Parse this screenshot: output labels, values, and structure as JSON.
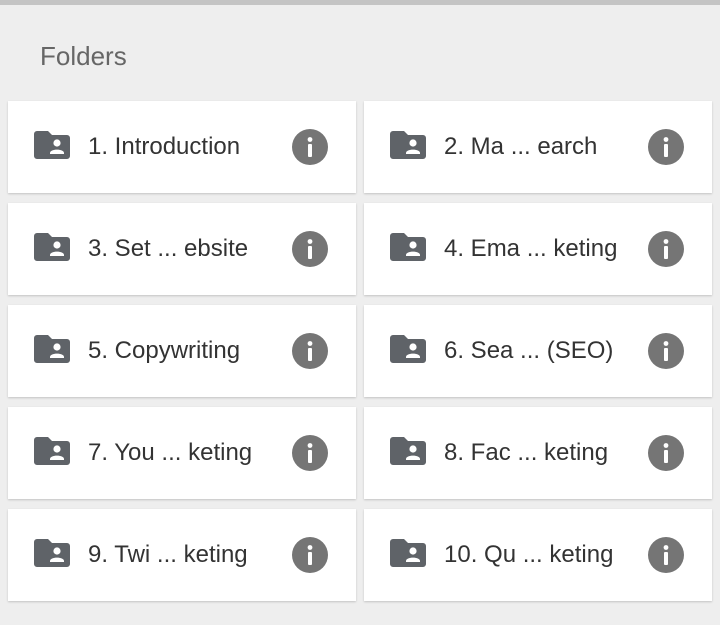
{
  "header": {
    "title": "Folders"
  },
  "folders": [
    {
      "label": "1. Introduction",
      "icon": "folder-shared-icon"
    },
    {
      "label": "2. Ma ... earch",
      "icon": "folder-shared-icon"
    },
    {
      "label": "3. Set ... ebsite",
      "icon": "folder-shared-icon"
    },
    {
      "label": "4. Ema ... keting",
      "icon": "folder-shared-icon"
    },
    {
      "label": "5. Copywriting",
      "icon": "folder-shared-icon"
    },
    {
      "label": "6. Sea ... (SEO)",
      "icon": "folder-shared-icon"
    },
    {
      "label": "7. You ... keting",
      "icon": "folder-shared-icon"
    },
    {
      "label": "8. Fac ... keting",
      "icon": "folder-shared-icon"
    },
    {
      "label": "9. Twi ... keting",
      "icon": "folder-shared-icon"
    },
    {
      "label": "10. Qu ... keting",
      "icon": "folder-shared-icon"
    }
  ],
  "colors": {
    "background": "#eeeeee",
    "card": "#ffffff",
    "icon": "#5f6368",
    "text": "#333333",
    "title": "#666666"
  }
}
